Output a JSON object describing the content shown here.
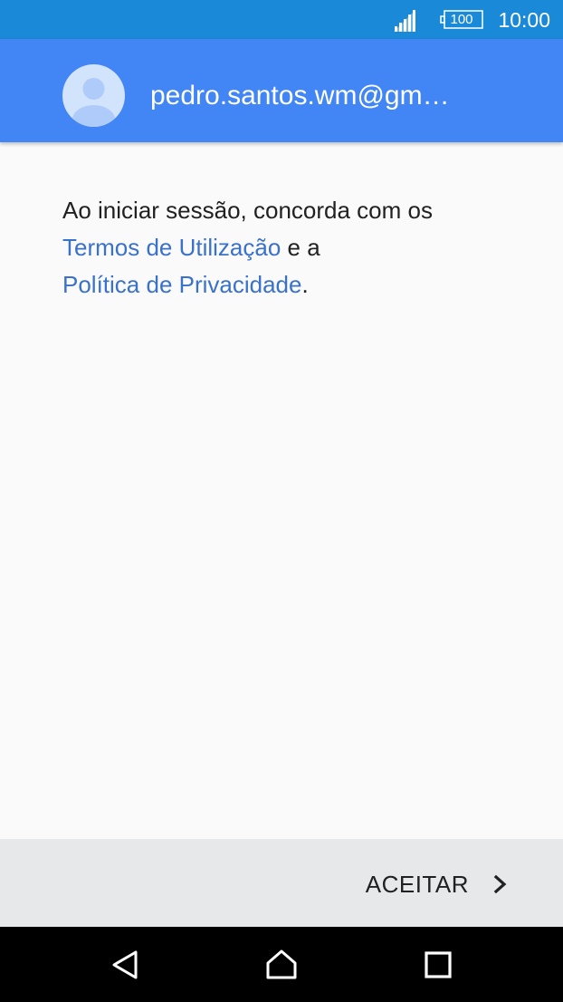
{
  "status_bar": {
    "time": "10:00",
    "battery_level": "100",
    "signal_icon": "cellular-signal-icon",
    "battery_icon": "battery-icon"
  },
  "header": {
    "email": "pedro.santos.wm@gm…",
    "avatar_icon": "account-avatar-icon"
  },
  "content": {
    "intro_text": "Ao iniciar sessão, concorda com os",
    "terms_link": "Termos de Utilização",
    "conjunction": " e a",
    "privacy_link": "Política de Privacidade",
    "period": "."
  },
  "footer": {
    "accept_label": "ACEITAR",
    "accept_icon": "chevron-right-icon"
  },
  "nav_bar": {
    "back_icon": "back-icon",
    "home_icon": "home-icon",
    "recents_icon": "recents-icon"
  },
  "colors": {
    "status_bar": "#1a8ad8",
    "header": "#4285f4",
    "link": "#3a71c9",
    "background": "#fafafa",
    "footer": "#e6e8ea"
  }
}
